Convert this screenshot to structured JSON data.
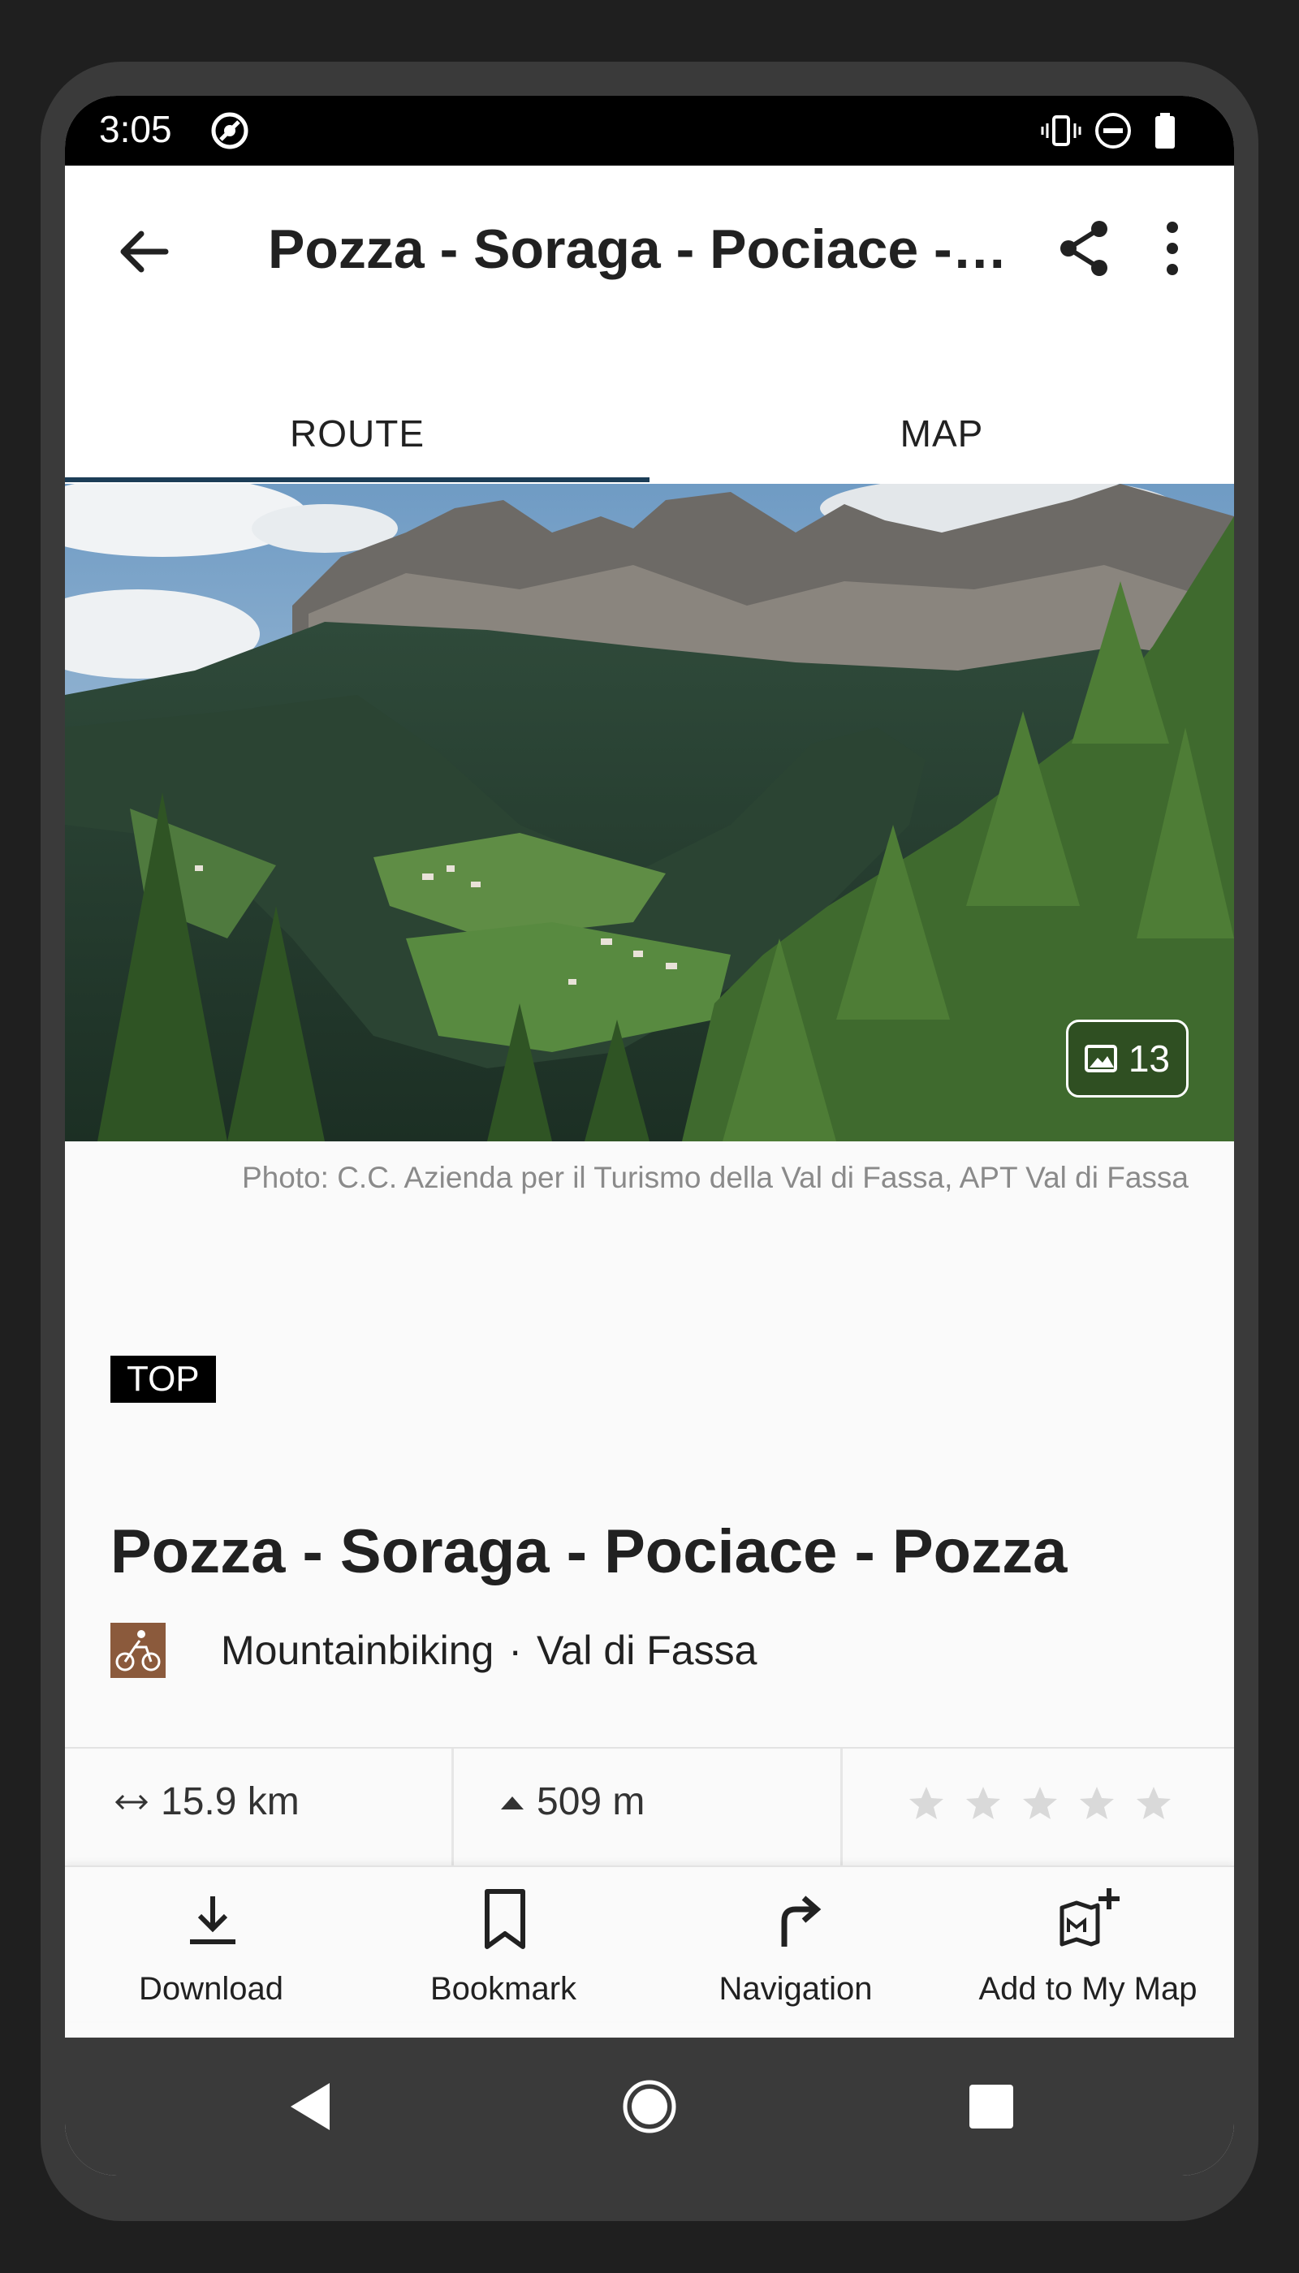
{
  "status_bar": {
    "time": "3:05",
    "icons": [
      "sync-icon",
      "vibrate-icon",
      "do-not-disturb-icon",
      "battery-icon"
    ]
  },
  "app_bar": {
    "title": "Pozza - Soraga - Pociace - Pozza",
    "icons": [
      "back-arrow-icon",
      "share-icon",
      "more-vert-icon"
    ]
  },
  "tabs": [
    {
      "label": "ROUTE",
      "selected": true
    },
    {
      "label": "MAP",
      "selected": false
    }
  ],
  "hero": {
    "photo_count": "13",
    "credit": "Photo: C.C. Azienda per il Turismo della Val di Fassa, APT Val di Fassa"
  },
  "badge": "TOP",
  "route": {
    "title": "Pozza - Soraga - Pociace - Pozza",
    "category": "Mountainbiking",
    "separator": "·",
    "region": "Val di Fassa",
    "category_icon_color": "#8b5a3c"
  },
  "stats": {
    "distance": "15.9 km",
    "ascent": "509 m",
    "rating_stars": 5,
    "rating_filled": 0
  },
  "actions": [
    {
      "label": "Download",
      "icon": "download-icon"
    },
    {
      "label": "Bookmark",
      "icon": "bookmark-icon"
    },
    {
      "label": "Navigation",
      "icon": "turn-right-icon"
    },
    {
      "label": "Add to My Map",
      "icon": "add-to-map-icon"
    }
  ],
  "colors": {
    "tab_indicator": "#1c3d57",
    "navbar": "#3a3a3a"
  }
}
